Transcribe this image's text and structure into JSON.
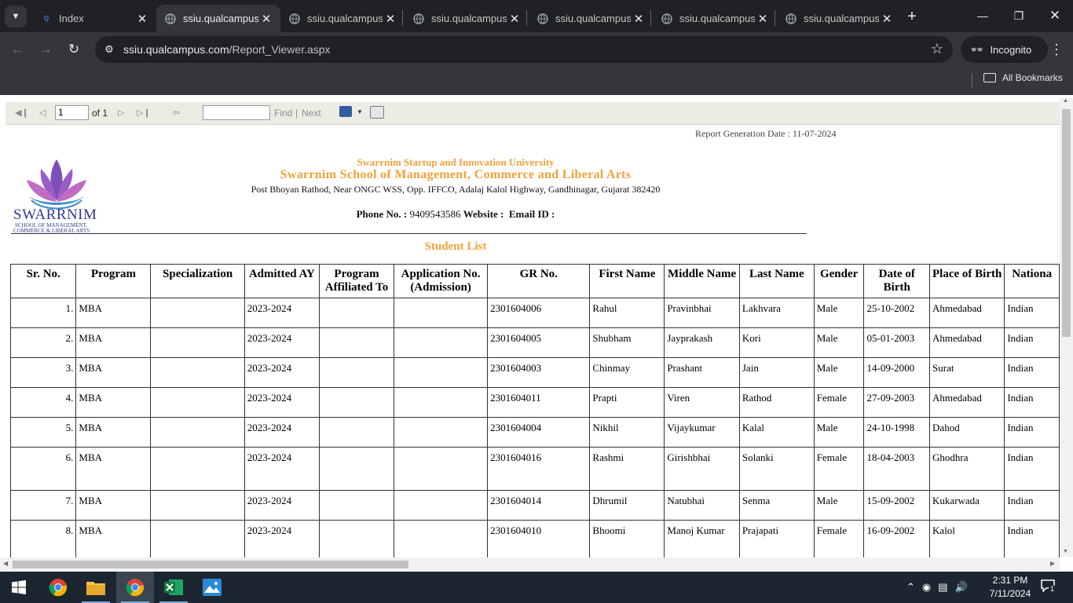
{
  "browser": {
    "tabs": [
      {
        "title": "Index",
        "favicon": "qualcampus-logo-icon",
        "active": false
      },
      {
        "title": "ssiu.qualcampus",
        "favicon": "globe-icon",
        "active": true
      },
      {
        "title": "ssiu.qualcampus",
        "favicon": "globe-icon",
        "active": false
      },
      {
        "title": "ssiu.qualcampus",
        "favicon": "globe-icon",
        "active": false
      },
      {
        "title": "ssiu.qualcampus",
        "favicon": "globe-icon",
        "active": false
      },
      {
        "title": "ssiu.qualcampus",
        "favicon": "globe-icon",
        "active": false
      },
      {
        "title": "ssiu.qualcampus",
        "favicon": "globe-icon",
        "active": false
      }
    ],
    "url_domain": "ssiu.qualcampus.com",
    "url_path": "/Report_Viewer.aspx",
    "incognito_label": "Incognito",
    "all_bookmarks_label": "All Bookmarks"
  },
  "viewer_toolbar": {
    "page_value": "1",
    "page_of": "of 1",
    "find_label": "Find",
    "separator": "|",
    "next_label": "Next"
  },
  "report": {
    "generation_date": "Report Generation Date : 11-07-2024",
    "logo_text": "SWARRNIM",
    "logo_sub1": "SCHOOL OF MANAGEMENT,",
    "logo_sub2": "COMMERCE & LIBERAL ARTS",
    "university": "Swarrnim Startup and Innovation University",
    "school": "Swarrnim School of Management, Commerce and Liberal Arts",
    "address": "Post Bhoyan Rathod, Near ONGC WSS, Opp. IFFCO, Adalaj Kalol Highway, Gandhinagar, Gujarat 382420",
    "phone_label": "Phone No. :",
    "phone_value": "9409543586",
    "website_label": "Website :",
    "email_label": "Email ID :",
    "list_title": "Student List"
  },
  "table": {
    "headers": [
      "Sr. No.",
      "Program",
      "Specialization",
      "Admitted AY",
      "Program Affiliated To",
      "Application No. (Admission)",
      "GR No.",
      "First Name",
      "Middle Name",
      "Last Name",
      "Gender",
      "Date of Birth",
      "Place of Birth",
      "Nationa"
    ],
    "rows": [
      [
        "1.",
        "MBA",
        "",
        "2023-2024",
        "",
        "",
        "2301604006",
        "Rahul",
        "Pravinbhai",
        "Lakhvara",
        "Male",
        "25-10-2002",
        "Ahmedabad",
        "Indian"
      ],
      [
        "2.",
        "MBA",
        "",
        "2023-2024",
        "",
        "",
        "2301604005",
        "Shubham",
        "Jayprakash",
        "Kori",
        "Male",
        "05-01-2003",
        "Ahmedabad",
        "Indian"
      ],
      [
        "3.",
        "MBA",
        "",
        "2023-2024",
        "",
        "",
        "2301604003",
        "Chinmay",
        "Prashant",
        "Jain",
        "Male",
        "14-09-2000",
        "Surat",
        "Indian"
      ],
      [
        "4.",
        "MBA",
        "",
        "2023-2024",
        "",
        "",
        "2301604011",
        "Prapti",
        "Viren",
        "Rathod",
        "Female",
        "27-09-2003",
        "Ahmedabad",
        "Indian"
      ],
      [
        "5.",
        "MBA",
        "",
        "2023-2024",
        "",
        "",
        "2301604004",
        "Nikhil",
        "Vijaykumar",
        "Kalal",
        "Male",
        "24-10-1998",
        "Dahod",
        "Indian"
      ],
      [
        "6.",
        "MBA",
        "",
        "2023-2024",
        "",
        "",
        "2301604016",
        "Rashmi",
        "Girishbhai",
        "Solanki",
        "Female",
        "18-04-2003",
        "Ghodhra",
        "Indian"
      ],
      [
        "7.",
        "MBA",
        "",
        "2023-2024",
        "",
        "",
        "2301604014",
        "Dhrumil",
        "Natubhai",
        "Senma",
        "Male",
        "15-09-2002",
        "Kukarwada",
        "Indian"
      ],
      [
        "8.",
        "MBA",
        "",
        "2023-2024",
        "",
        "",
        "2301604010",
        "Bhoomi",
        "Manoj Kumar",
        "Prajapati",
        "Female",
        "16-09-2002",
        "Kalol",
        "Indian"
      ]
    ]
  },
  "taskbar": {
    "time": "2:31 PM",
    "date": "7/11/2024",
    "notification_count": "1"
  },
  "colors": {
    "accent_orange": "#f0a23a",
    "logo_blue": "#2f3a8f",
    "chrome_dark": "#202124",
    "chrome_toolbar": "#35363a"
  }
}
